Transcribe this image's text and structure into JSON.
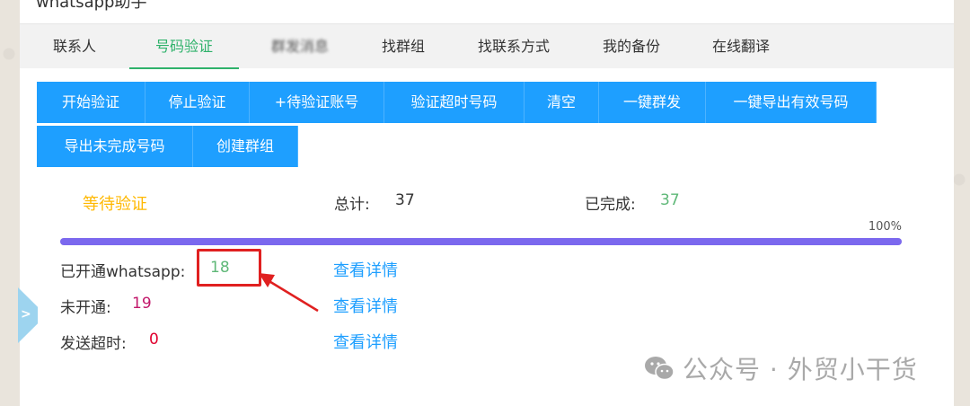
{
  "window": {
    "title": "whatsapp助手"
  },
  "tabs": [
    {
      "label": "联系人",
      "active": false
    },
    {
      "label": "号码验证",
      "active": true
    },
    {
      "label": "群发消息",
      "active": false
    },
    {
      "label": "找群组",
      "active": false
    },
    {
      "label": "找联系方式",
      "active": false
    },
    {
      "label": "我的备份",
      "active": false
    },
    {
      "label": "在线翻译",
      "active": false
    }
  ],
  "toolbar": {
    "buttons": [
      "开始验证",
      "停止验证",
      "+待验证账号",
      "验证超时号码",
      "清空",
      "一键群发",
      "一键导出有效号码",
      "导出未完成号码",
      "创建群组"
    ]
  },
  "status": {
    "state": "等待验证",
    "total_label": "总计:",
    "total_value": "37",
    "done_label": "已完成:",
    "done_value": "37",
    "progress_text": "100%",
    "progress_fraction": 1.0
  },
  "results": [
    {
      "label": "已开通whatsapp:",
      "value": "18",
      "link": "查看详情"
    },
    {
      "label": "未开通:",
      "value": "19",
      "link": "查看详情"
    },
    {
      "label": "发送超时:",
      "value": "0",
      "link": "查看详情"
    }
  ],
  "colors": {
    "accent_green": "#2fb26b",
    "button_blue": "#1e9fff",
    "progress_purple": "#7b68ee",
    "highlight_red": "#e02020"
  },
  "icons": {
    "side_toggle": "chevron-right-icon",
    "watermark": "wechat-icon"
  },
  "watermark": {
    "text": "公众号 · 外贸小干货"
  }
}
